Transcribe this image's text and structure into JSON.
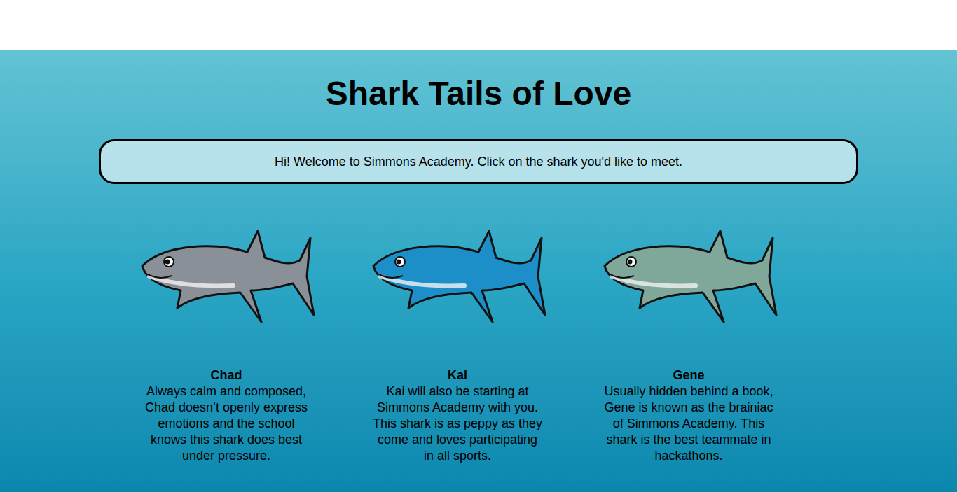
{
  "title": "Shark Tails of Love",
  "welcome": "Hi! Welcome to Simmons Academy. Click on the shark you'd like to meet.",
  "sharks": [
    {
      "name": "Chad",
      "description": "Always calm and composed, Chad doesn’t openly express emotions and the school knows this shark does best under pressure.",
      "color": "#8a9098"
    },
    {
      "name": "Kai",
      "description": "Kai will also be starting at Simmons Academy with you. This shark is as peppy as they come and loves participating in all sports.",
      "color": "#1c8fc8"
    },
    {
      "name": "Gene",
      "description": "Usually hidden behind a book, Gene is known as the brainiac of Simmons Academy. This shark is the best teammate in hackathons.",
      "color": "#7fa79a"
    }
  ]
}
